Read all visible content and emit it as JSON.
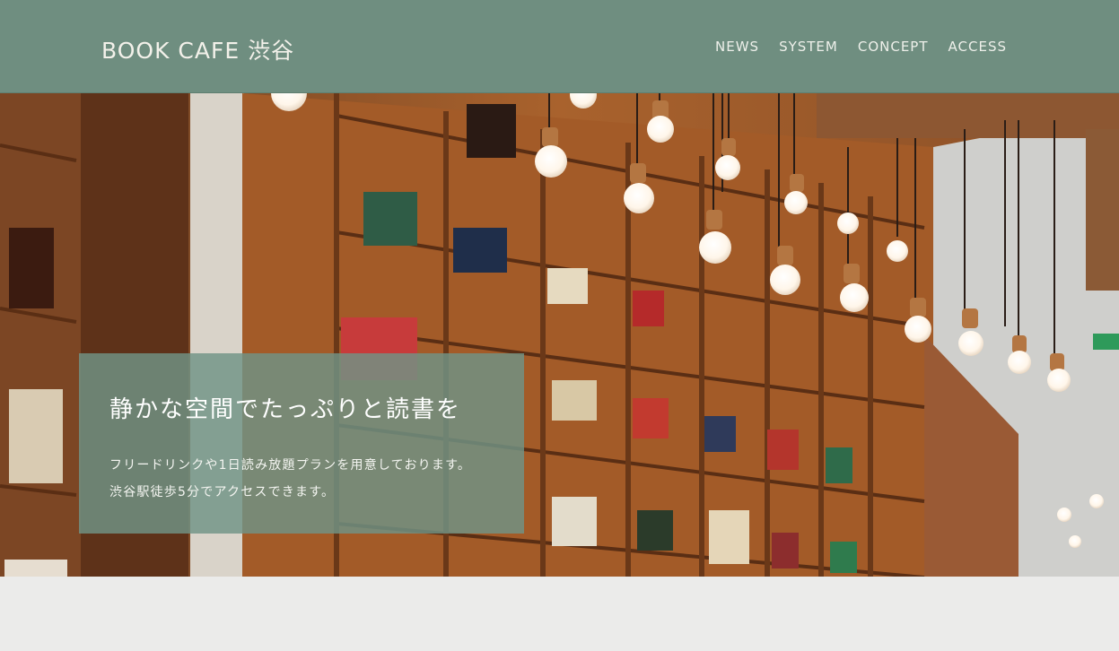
{
  "header": {
    "logo": "BOOK CAFE 渋谷",
    "nav": [
      "NEWS",
      "SYSTEM",
      "CONCEPT",
      "ACCESS"
    ]
  },
  "hero": {
    "heading": "静かな空間でたっぷりと読書を",
    "description_lines": [
      "フリードリンクや1日読み放題プランを用意しております。",
      "渋谷駅徒歩5分でアクセスできます。"
    ]
  },
  "colors": {
    "header_bg": "#6f8e80",
    "caption_bg": "#709486",
    "page_bg": "#ebebea"
  }
}
